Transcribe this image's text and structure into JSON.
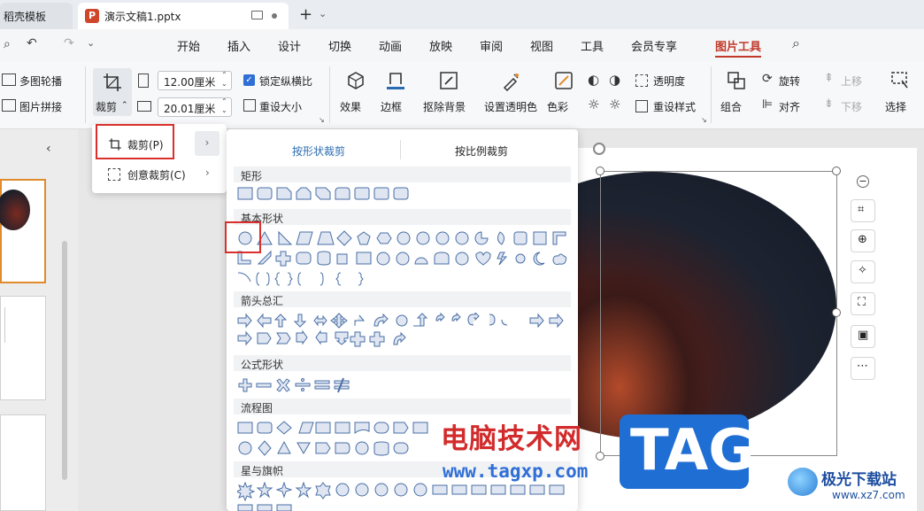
{
  "tabs": {
    "template": "稻壳模板",
    "document": "演示文稿1.pptx"
  },
  "menu": [
    "开始",
    "插入",
    "设计",
    "切换",
    "动画",
    "放映",
    "审阅",
    "视图",
    "工具",
    "会员专享",
    "图片工具"
  ],
  "ribbon": {
    "multi_outline": "多图轮播",
    "image_stitch": "图片拼接",
    "crop": "裁剪",
    "height_value": "12.00厘米",
    "width_value": "20.01厘米",
    "lock_ratio": "锁定纵横比",
    "reset_size": "重设大小",
    "effects": "效果",
    "border": "边框",
    "remove_bg": "抠除背景",
    "set_transparent": "设置透明色",
    "color": "色彩",
    "transparency": "透明度",
    "reset_style": "重设样式",
    "combine": "组合",
    "rotate": "旋转",
    "align": "对齐",
    "move_up": "上移",
    "move_down": "下移",
    "select": "选择"
  },
  "crop_menu": {
    "crop_item": "裁剪(P)",
    "creative_crop": "创意裁剪(C)"
  },
  "shape_panel": {
    "tab_by_shape": "按形状裁剪",
    "tab_by_ratio": "按比例裁剪",
    "categories": [
      "矩形",
      "基本形状",
      "箭头总汇",
      "公式形状",
      "流程图",
      "星与旗帜"
    ]
  },
  "watermark": {
    "site_cn": "电脑技术网",
    "site_url": "www.tagxp.com",
    "tag": "TAG",
    "corner": "极光下载站",
    "corner_url": "www.xz7.com"
  },
  "colors": {
    "accent": "#c0392b",
    "blue": "#2b6cb0",
    "red_frame": "#d9302c"
  }
}
